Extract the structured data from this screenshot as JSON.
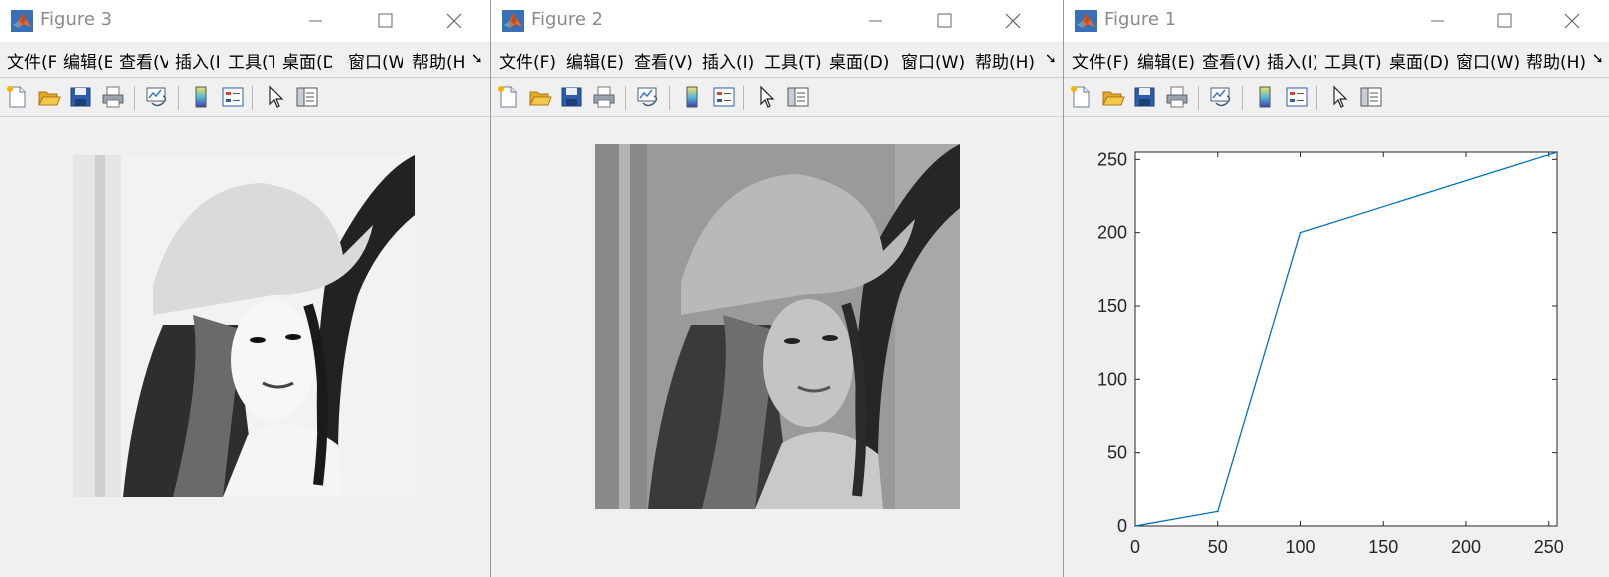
{
  "windows": [
    {
      "title": "Figure 3",
      "menu": [
        "文件(F",
        "编辑(E",
        "查看(V",
        "插入(I",
        "工具(T",
        "桌面(D",
        "窗口(W",
        "帮助(H"
      ],
      "overflow": "➘",
      "image": "lena-contrast-stretched",
      "toolbar_icons": [
        "new-figure-icon",
        "open-file-icon",
        "save-icon",
        "print-icon",
        "link-plot-icon",
        "colorbar-icon",
        "legend-icon",
        "pointer-icon",
        "property-inspector-icon"
      ]
    },
    {
      "title": "Figure 2",
      "menu": [
        "文件(F)",
        "编辑(E)",
        "查看(V)",
        "插入(I)",
        "工具(T)",
        "桌面(D)",
        "窗口(W)",
        "帮助(H)"
      ],
      "overflow": "➘",
      "image": "lena-original-grayscale",
      "toolbar_icons": [
        "new-figure-icon",
        "open-file-icon",
        "save-icon",
        "print-icon",
        "link-plot-icon",
        "colorbar-icon",
        "legend-icon",
        "pointer-icon",
        "property-inspector-icon"
      ]
    },
    {
      "title": "Figure 1",
      "menu": [
        "文件(F)",
        "编辑(E)",
        "查看(V)",
        "插入(I)",
        "工具(T)",
        "桌面(D)",
        "窗口(W)",
        "帮助(H)"
      ],
      "overflow": "➘",
      "image": "",
      "toolbar_icons": [
        "new-figure-icon",
        "open-file-icon",
        "save-icon",
        "print-icon",
        "link-plot-icon",
        "colorbar-icon",
        "legend-icon",
        "pointer-icon",
        "property-inspector-icon"
      ]
    }
  ],
  "colors": {
    "line": "#0072bd",
    "titlebar": "#ffffff",
    "window_bg": "#f0f0f0",
    "title_text": "#8a8a8a"
  },
  "chart_data": {
    "type": "line",
    "x": [
      0,
      50,
      100,
      255
    ],
    "series": [
      {
        "values": [
          0,
          10,
          200,
          255
        ]
      }
    ],
    "xlim": [
      0,
      255
    ],
    "ylim": [
      0,
      255
    ],
    "xticks": [
      "0",
      "50",
      "100",
      "150",
      "200",
      "250"
    ],
    "yticks": [
      "0",
      "50",
      "100",
      "150",
      "200",
      "250"
    ],
    "title": "",
    "xlabel": "",
    "ylabel": "",
    "grid": false
  }
}
